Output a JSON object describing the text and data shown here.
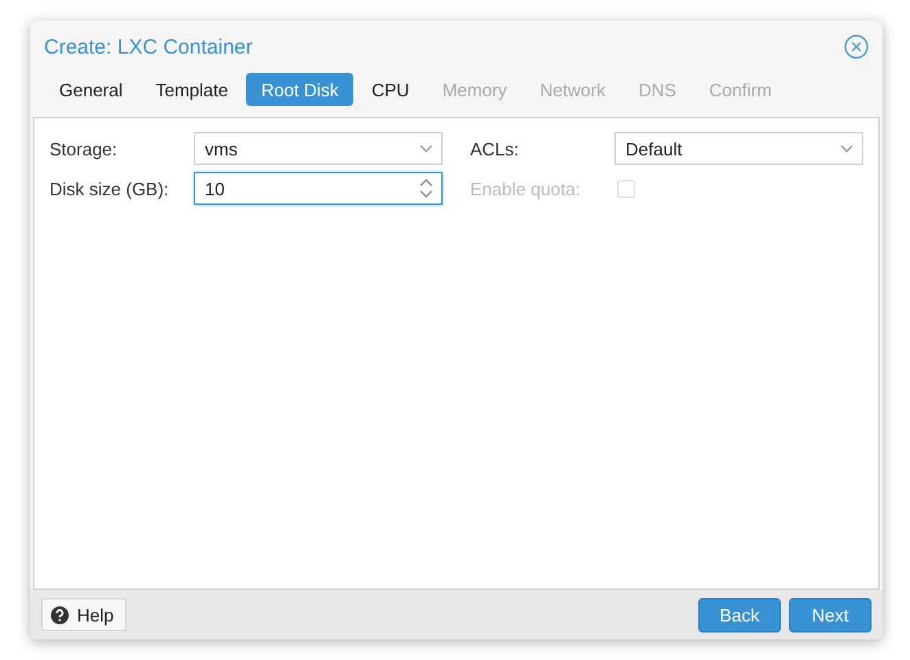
{
  "window": {
    "title": "Create: LXC Container"
  },
  "tabs": [
    {
      "label": "General",
      "selected": false,
      "disabled": false
    },
    {
      "label": "Template",
      "selected": false,
      "disabled": false
    },
    {
      "label": "Root Disk",
      "selected": true,
      "disabled": false
    },
    {
      "label": "CPU",
      "selected": false,
      "disabled": false
    },
    {
      "label": "Memory",
      "selected": false,
      "disabled": true
    },
    {
      "label": "Network",
      "selected": false,
      "disabled": true
    },
    {
      "label": "DNS",
      "selected": false,
      "disabled": true
    },
    {
      "label": "Confirm",
      "selected": false,
      "disabled": true
    }
  ],
  "columns": [
    [
      {
        "kind": "combo",
        "label": "Storage:",
        "value": "vms",
        "focused": false,
        "disabled": false
      },
      {
        "kind": "spinner",
        "label": "Disk size (GB):",
        "value": "10",
        "focused": true,
        "disabled": false
      }
    ],
    [
      {
        "kind": "combo",
        "label": "ACLs:",
        "value": "Default",
        "focused": false,
        "disabled": false
      },
      {
        "kind": "checkbox",
        "label": "Enable quota:",
        "checked": false,
        "focused": false,
        "disabled": true
      }
    ]
  ],
  "footer": {
    "help": "Help",
    "buttons": [
      "Back",
      "Next"
    ]
  }
}
